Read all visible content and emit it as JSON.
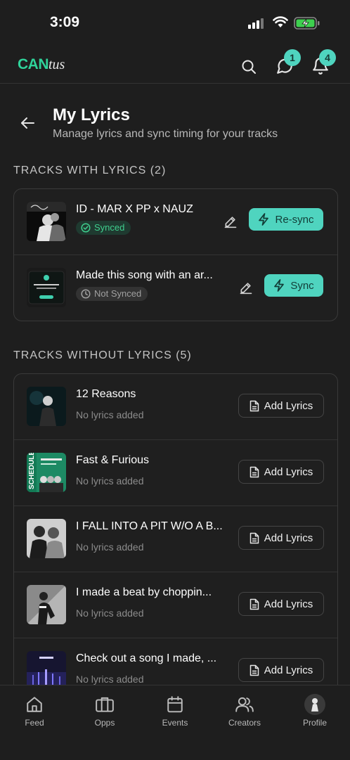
{
  "status": {
    "time": "3:09"
  },
  "app": {
    "logo_part1": "CAN",
    "logo_part2": "tus",
    "messages_badge": "1",
    "notifications_badge": "4"
  },
  "page": {
    "title": "My Lyrics",
    "subtitle": "Manage lyrics and sync timing for your tracks"
  },
  "with_lyrics": {
    "heading": "TRACKS WITH LYRICS (2)",
    "tracks": [
      {
        "title": "ID - MAR X PP x NAUZ",
        "status": "Synced",
        "action": "Re-sync"
      },
      {
        "title": "Made this song with an ar...",
        "status": "Not Synced",
        "action": "Sync"
      }
    ]
  },
  "without_lyrics": {
    "heading": "TRACKS WITHOUT LYRICS (5)",
    "add_label": "Add Lyrics",
    "tracks": [
      {
        "title": "12 Reasons",
        "sub": "No lyrics added"
      },
      {
        "title": "Fast & Furious",
        "sub": "No lyrics added"
      },
      {
        "title": "I FALL INTO A PIT W/O A B...",
        "sub": "No lyrics added"
      },
      {
        "title": "I made a beat by choppin...",
        "sub": "No lyrics added"
      },
      {
        "title": "Check out a song I made, ...",
        "sub": "No lyrics added"
      }
    ]
  },
  "thumb_text": {
    "schedule": "SCHEDULE"
  },
  "nav": {
    "items": [
      {
        "label": "Feed",
        "icon": "home-icon"
      },
      {
        "label": "Opps",
        "icon": "briefcase-icon"
      },
      {
        "label": "Events",
        "icon": "calendar-icon"
      },
      {
        "label": "Creators",
        "icon": "users-icon"
      },
      {
        "label": "Profile",
        "icon": "avatar"
      }
    ]
  },
  "colors": {
    "accent": "#4fd4bf",
    "brand": "#2fd39a",
    "background": "#1e1e1e"
  }
}
